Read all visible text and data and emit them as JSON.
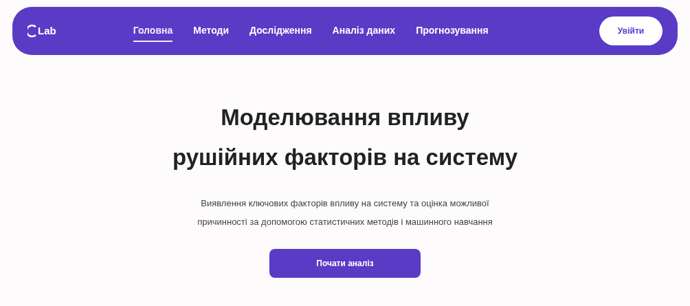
{
  "nav": {
    "logo": "Lab",
    "items": [
      {
        "label": "Головна",
        "selected": true
      },
      {
        "label": "Методи",
        "selected": false
      },
      {
        "label": "Дослідження",
        "selected": false
      },
      {
        "label": "Аналіз даних",
        "selected": false
      },
      {
        "label": "Прогнозування",
        "selected": false
      }
    ],
    "login": "Увійти"
  },
  "hero": {
    "title_lines": [
      "Моделювання впливу",
      "рушійних факторів на систему"
    ],
    "description": "Виявлення ключових факторів впливу на систему та оцінка можливої причинності за допомогою статистичних методів і машинного навчання",
    "button": "Почати аналіз"
  }
}
